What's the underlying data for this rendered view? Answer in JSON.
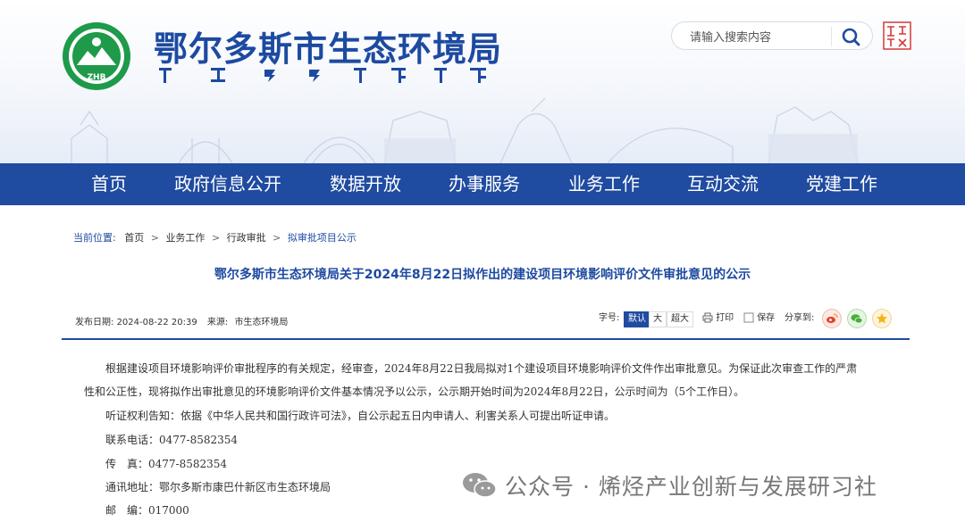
{
  "header": {
    "title": "鄂尔多斯市生态环境局",
    "logo_text": "ZHB"
  },
  "search": {
    "placeholder": "请输入搜索内容"
  },
  "nav": {
    "items": [
      "首页",
      "政府信息公开",
      "数据开放",
      "办事服务",
      "业务工作",
      "互动交流",
      "党建工作"
    ]
  },
  "breadcrumb": {
    "label": "当前位置:",
    "items": [
      "首页",
      "业务工作",
      "行政审批",
      "拟审批项目公示"
    ]
  },
  "article": {
    "title": "鄂尔多斯市生态环境局关于2024年8月22日拟作出的建设项目环境影响评价文件审批意见的公示",
    "publish_label": "发布日期:",
    "publish_date": "2024-08-22 20:39",
    "source_label": "来源:",
    "source": "市生态环境局",
    "paragraphs": [
      "根据建设项目环境影响评价审批程序的有关规定，经审查，2024年8月22日我局拟对1个建设项目环境影响评价文件作出审批意见。为保证此次审查工作的严肃",
      "性和公正性，现将拟作出审批意见的环境影响评价文件基本情况予以公示，公示期开始时间为2024年8月22日，公示时间为（5个工作日）。",
      "听证权利告知：依据《中华人民共和国行政许可法》，自公示起五日内申请人、利害关系人可提出听证申请。",
      "联系电话：0477-8582354",
      "传　真：0477-8582354",
      "通讯地址：鄂尔多斯市康巴什新区市生态环境局",
      "邮　编：017000"
    ]
  },
  "tools": {
    "font_label": "字号:",
    "font_sizes": [
      "默认",
      "大",
      "超大"
    ],
    "print": "打印",
    "save": "保存",
    "share_label": "分享到:"
  },
  "watermark": {
    "text": "公众号 · 烯烃产业创新与发展研习社"
  },
  "colors": {
    "brand": "#1f4ba0",
    "title": "#1d4aa1",
    "text": "#333333"
  }
}
